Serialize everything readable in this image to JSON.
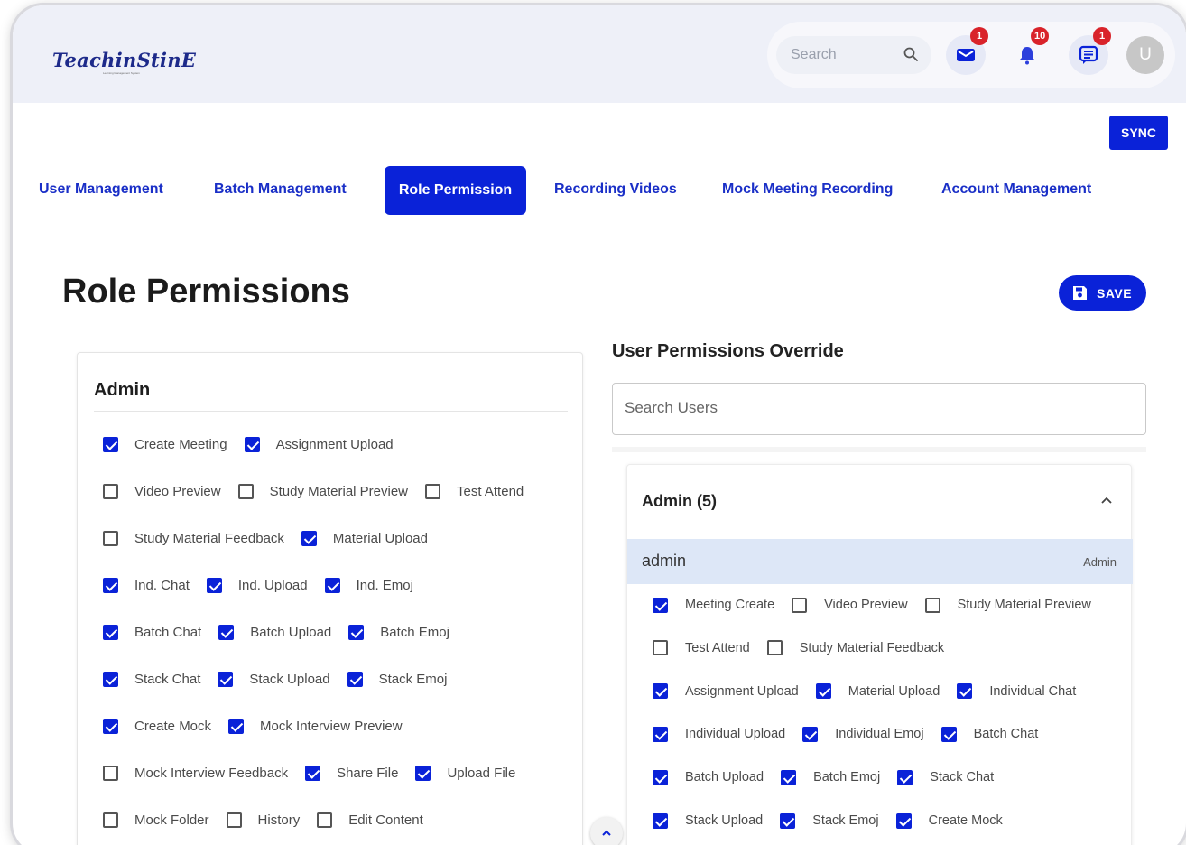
{
  "app": {
    "logo": "TeachinStinE",
    "logo_tagline": "Learning Management System"
  },
  "header": {
    "search_placeholder": "Search",
    "mail_badge": "1",
    "notification_badge": "10",
    "chat_badge": "1",
    "avatar_initial": "U"
  },
  "toolbar": {
    "sync_label": "SYNC"
  },
  "tabs": [
    {
      "label": "User Management"
    },
    {
      "label": "Batch Management"
    },
    {
      "label": "Role Permission"
    },
    {
      "label": "Recording Videos"
    },
    {
      "label": "Mock Meeting Recording"
    },
    {
      "label": "Account Management"
    }
  ],
  "page": {
    "title": "Role Permissions",
    "save_label": "SAVE"
  },
  "role_card": {
    "title": "Admin",
    "rows": [
      [
        {
          "label": "Create Meeting",
          "checked": true
        },
        {
          "label": "Assignment Upload",
          "checked": true
        }
      ],
      [
        {
          "label": "Video Preview",
          "checked": false
        },
        {
          "label": "Study Material Preview",
          "checked": false
        },
        {
          "label": "Test Attend",
          "checked": false
        }
      ],
      [
        {
          "label": "Study Material Feedback",
          "checked": false
        },
        {
          "label": "Material Upload",
          "checked": true
        }
      ],
      [
        {
          "label": "Ind. Chat",
          "checked": true
        },
        {
          "label": "Ind. Upload",
          "checked": true
        },
        {
          "label": "Ind. Emoj",
          "checked": true
        }
      ],
      [
        {
          "label": "Batch Chat",
          "checked": true
        },
        {
          "label": "Batch Upload",
          "checked": true
        },
        {
          "label": "Batch Emoj",
          "checked": true
        }
      ],
      [
        {
          "label": "Stack Chat",
          "checked": true
        },
        {
          "label": "Stack Upload",
          "checked": true
        },
        {
          "label": "Stack Emoj",
          "checked": true
        }
      ],
      [
        {
          "label": "Create Mock",
          "checked": true
        },
        {
          "label": "Mock Interview Preview",
          "checked": true
        }
      ],
      [
        {
          "label": "Mock Interview Feedback",
          "checked": false
        },
        {
          "label": "Share File",
          "checked": true
        },
        {
          "label": "Upload File",
          "checked": true
        }
      ],
      [
        {
          "label": "Mock Folder",
          "checked": false
        },
        {
          "label": "History",
          "checked": false
        },
        {
          "label": "Edit Content",
          "checked": false
        }
      ]
    ]
  },
  "override": {
    "title": "User Permissions Override",
    "search_placeholder": "Search Users",
    "group_label": "Admin (5)",
    "user": {
      "name": "admin",
      "role": "Admin"
    },
    "rows": [
      [
        {
          "label": "Meeting Create",
          "checked": true
        },
        {
          "label": "Video Preview",
          "checked": false
        },
        {
          "label": "Study Material Preview",
          "checked": false
        }
      ],
      [
        {
          "label": "Test Attend",
          "checked": false
        },
        {
          "label": "Study Material Feedback",
          "checked": false
        }
      ],
      [
        {
          "label": "Assignment Upload",
          "checked": true
        },
        {
          "label": "Material Upload",
          "checked": true
        },
        {
          "label": "Individual Chat",
          "checked": true
        }
      ],
      [
        {
          "label": "Individual Upload",
          "checked": true
        },
        {
          "label": "Individual Emoj",
          "checked": true
        },
        {
          "label": "Batch Chat",
          "checked": true
        }
      ],
      [
        {
          "label": "Batch Upload",
          "checked": true
        },
        {
          "label": "Batch Emoj",
          "checked": true
        },
        {
          "label": "Stack Chat",
          "checked": true
        }
      ],
      [
        {
          "label": "Stack Upload",
          "checked": true
        },
        {
          "label": "Stack Emoj",
          "checked": true
        },
        {
          "label": "Create Mock",
          "checked": true
        }
      ]
    ]
  },
  "colors": {
    "accent": "#0a22d8",
    "badge": "#d9232a",
    "header_bg": "#eef0f8",
    "selected_row": "#dde7f7"
  },
  "icons": [
    "search-icon",
    "mail-icon",
    "bell-icon",
    "chat-icon",
    "save-icon",
    "chevron-up-icon"
  ]
}
